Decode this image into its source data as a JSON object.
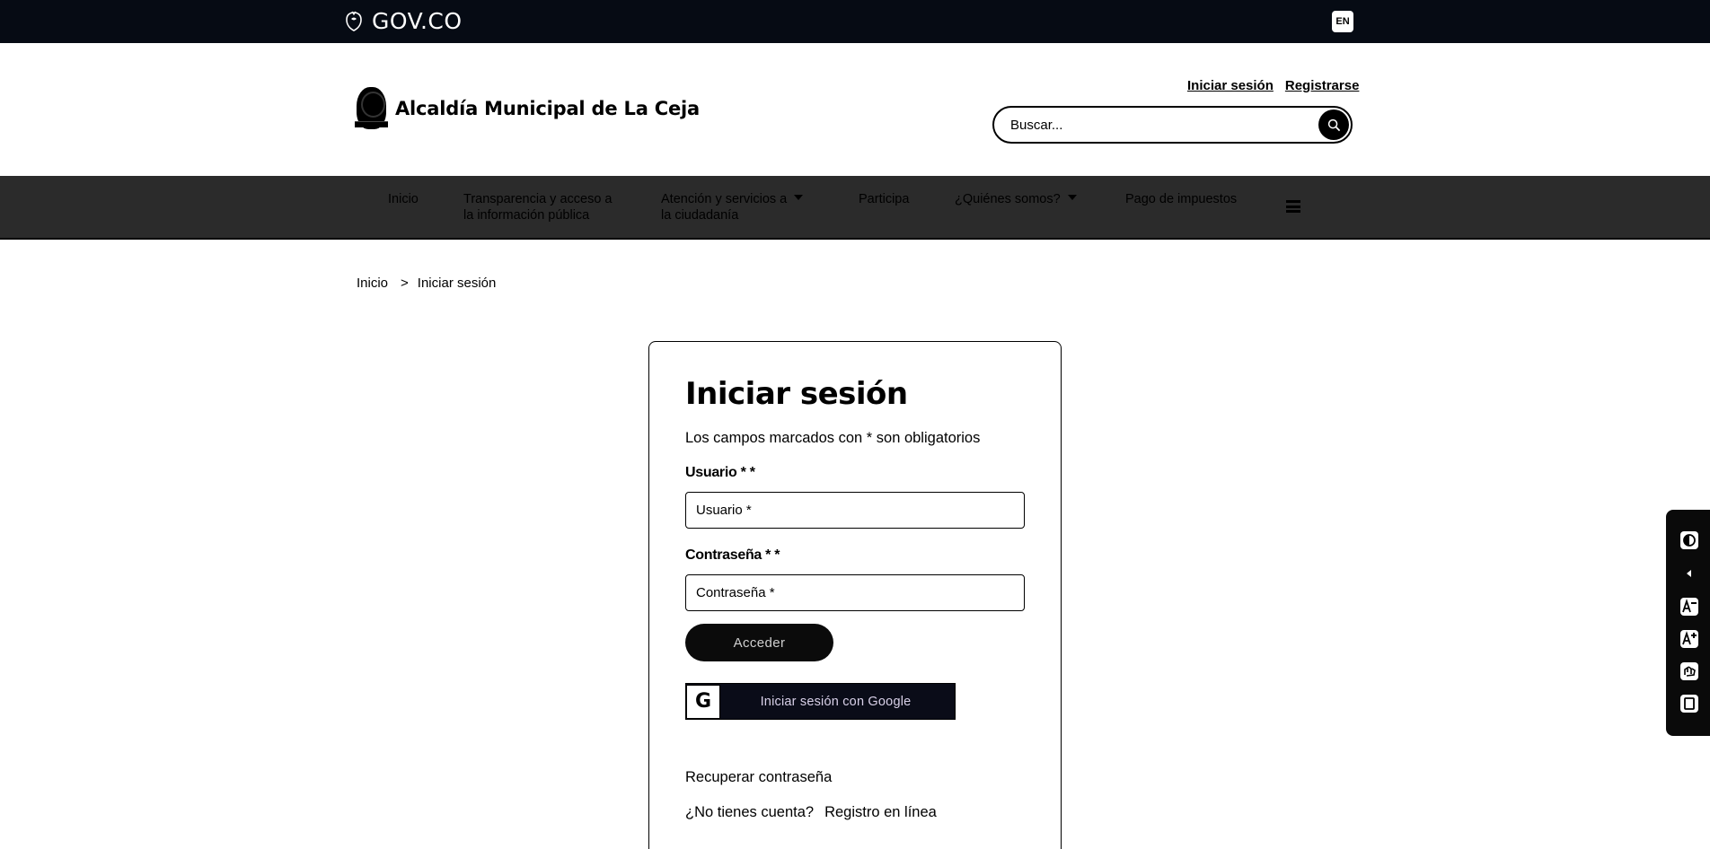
{
  "govbar": {
    "logo_text": "GOV.CO",
    "lang_label": "EN"
  },
  "header": {
    "site_name": "Alcaldía Municipal de La Ceja",
    "login_link": "Iniciar sesión",
    "register_link": "Registrarse",
    "search_placeholder": "Buscar..."
  },
  "nav": {
    "items": [
      {
        "label_line1": "Inicio",
        "label_line2": ""
      },
      {
        "label_line1": "Transparencia y acceso a",
        "label_line2": "la información pública"
      },
      {
        "label_line1": "Atención y servicios a",
        "label_line2": "la ciudadanía"
      },
      {
        "label_line1": "Participa",
        "label_line2": ""
      },
      {
        "label_line1": "¿Quiénes somos?",
        "label_line2": ""
      },
      {
        "label_line1": "Pago de impuestos",
        "label_line2": ""
      }
    ]
  },
  "breadcrumb": {
    "home": "Inicio",
    "separator": ">",
    "current": "Iniciar sesión"
  },
  "login": {
    "title": "Iniciar sesión",
    "required_note": "Los campos marcados con * son obligatorios",
    "username_label": "Usuario * *",
    "username_placeholder": "Usuario *",
    "password_label": "Contraseña * *",
    "password_placeholder": "Contraseña *",
    "submit_label": "Acceder",
    "google_icon_letter": "G",
    "google_label": "Iniciar sesión con Google",
    "recover_link": "Recuperar contraseña",
    "no_account_text": "¿No tienes cuenta?",
    "register_online_link": "Registro en línea"
  },
  "accessibility_bar": {
    "items": [
      "contrast-icon",
      "collapse-arrow-icon",
      "decrease-font-icon",
      "increase-font-icon",
      "sign-language-icon",
      "reader-icon"
    ]
  },
  "colors": {
    "govbar_bg": "#060b14",
    "nav_bg": "#2b2b2b",
    "button_bg": "#0b0b0b",
    "google_button_bg": "#0a0c18"
  }
}
